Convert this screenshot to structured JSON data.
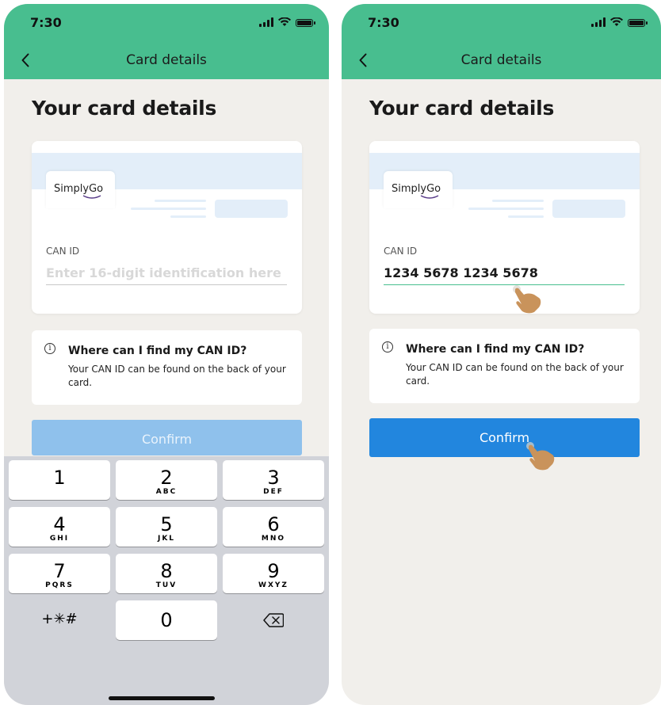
{
  "status_bar": {
    "time": "7:30"
  },
  "nav": {
    "title": "Card details"
  },
  "page": {
    "title": "Your card details"
  },
  "card": {
    "logo_text": "SimplyGo",
    "can_label": "CAN ID",
    "can_placeholder": "Enter 16-digit identification here",
    "can_value": "1234 5678 1234 5678"
  },
  "info": {
    "title": "Where can I find my CAN ID?",
    "text": "Your CAN ID can be found on the back of your card.",
    "icon": "info-icon"
  },
  "confirm_label": "Confirm",
  "keypad": {
    "keys": [
      {
        "digit": "1",
        "letters": ""
      },
      {
        "digit": "2",
        "letters": "ABC"
      },
      {
        "digit": "3",
        "letters": "DEF"
      },
      {
        "digit": "4",
        "letters": "GHI"
      },
      {
        "digit": "5",
        "letters": "JKL"
      },
      {
        "digit": "6",
        "letters": "MNO"
      },
      {
        "digit": "7",
        "letters": "PQRS"
      },
      {
        "digit": "8",
        "letters": "TUV"
      },
      {
        "digit": "9",
        "letters": "WXYZ"
      }
    ],
    "symbols": "+✳︎#",
    "zero": "0",
    "delete_icon": "backspace-icon"
  },
  "colors": {
    "header_green": "#48be8f",
    "confirm_active": "#2286de",
    "confirm_disabled": "#8fc1ec",
    "background": "#f1efeb",
    "keyboard": "#d1d3d9"
  }
}
